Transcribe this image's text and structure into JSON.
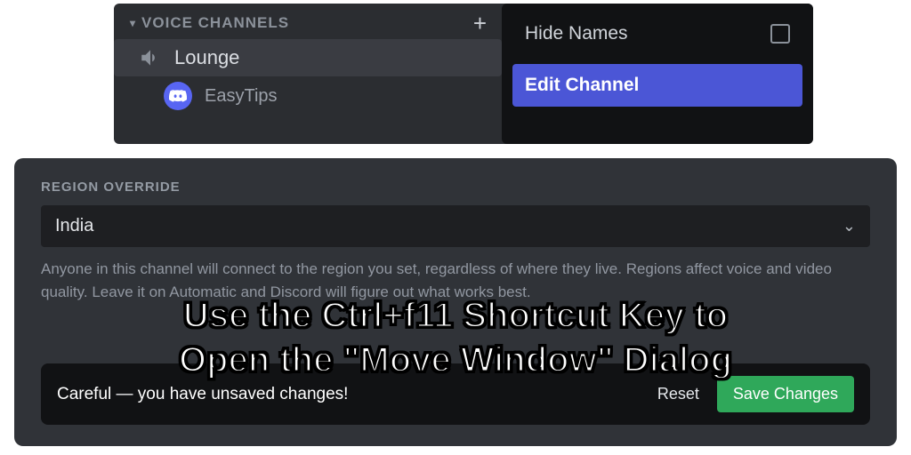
{
  "channels": {
    "category_label": "VOICE CHANNELS",
    "voice_channel": "Lounge",
    "user": "EasyTips"
  },
  "context_menu": {
    "hide_names": "Hide Names",
    "edit_channel": "Edit Channel"
  },
  "settings": {
    "region_label": "REGION OVERRIDE",
    "region_value": "India",
    "region_help": "Anyone in this channel will connect to the region you set, regardless of where they live. Regions affect voice and video quality. Leave it on Automatic and Discord will figure out what works best."
  },
  "save_bar": {
    "message": "Careful — you have unsaved changes!",
    "reset": "Reset",
    "save": "Save Changes"
  },
  "caption": {
    "line1": "Use the Ctrl+f11 Shortcut Key to",
    "line2": "Open the \"Move Window\" Dialog"
  }
}
